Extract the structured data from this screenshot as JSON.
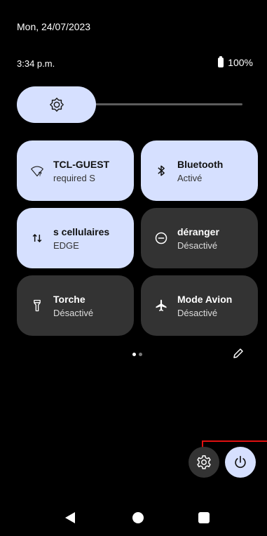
{
  "status": {
    "date": "Mon, 24/07/2023",
    "time": "3:34 p.m.",
    "battery": "100%"
  },
  "brightness": {
    "level": 0.35,
    "icon": "brightness-icon"
  },
  "tiles": [
    {
      "title": "TCL-GUEST",
      "subtitle": "required S",
      "state": "on",
      "icon": "wifi-question-icon"
    },
    {
      "title": "Bluetooth",
      "subtitle": "Activé",
      "state": "on",
      "icon": "bluetooth-icon"
    },
    {
      "title": "s cellulaires",
      "subtitle": "EDGE",
      "state": "on",
      "icon": "mobile-data-icon"
    },
    {
      "title": "déranger",
      "subtitle": "Désactivé",
      "state": "off",
      "icon": "do-not-disturb-icon"
    },
    {
      "title": "Torche",
      "subtitle": "Désactivé",
      "state": "off",
      "icon": "flashlight-icon"
    },
    {
      "title": "Mode Avion",
      "subtitle": "Désactivé",
      "state": "off",
      "icon": "airplane-icon"
    }
  ],
  "pager": {
    "pages": 2,
    "current": 1
  },
  "colors": {
    "tile_on": "#d6e0ff",
    "tile_off": "#333333",
    "highlight": "#e01010"
  }
}
